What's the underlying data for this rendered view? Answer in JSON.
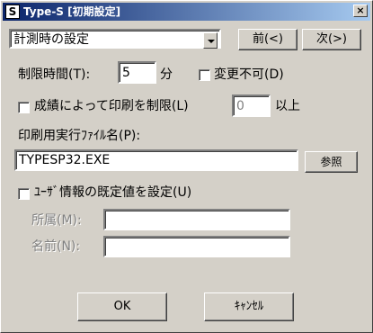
{
  "window": {
    "title": "Type-S [初期設定]",
    "icon_letter": "S",
    "close_glyph": "×"
  },
  "mode": {
    "selected": "計測時の設定",
    "prev_label": "前(<)",
    "next_label": "次(>)"
  },
  "time_limit": {
    "label": "制限時間(T):",
    "value": "5",
    "unit": "分",
    "lock_label": "変更不可(D)",
    "lock_checked": false
  },
  "print_limit": {
    "label": "成績によって印刷を制限(L)",
    "checked": false,
    "value": "0",
    "suffix": "以上"
  },
  "print_exe": {
    "label": "印刷用実行ﾌｧｲﾙ名(P):",
    "value": "TYPESP32.EXE",
    "browse_label": "参照"
  },
  "user_info": {
    "checkbox_label": "ﾕｰｻﾞ情報の既定値を設定(U)",
    "checked": false,
    "affiliation_label": "所属(M):",
    "affiliation_value": "",
    "name_label": "名前(N):",
    "name_value": ""
  },
  "footer": {
    "ok_label": "OK",
    "cancel_label": "ｷｬﾝｾﾙ"
  }
}
